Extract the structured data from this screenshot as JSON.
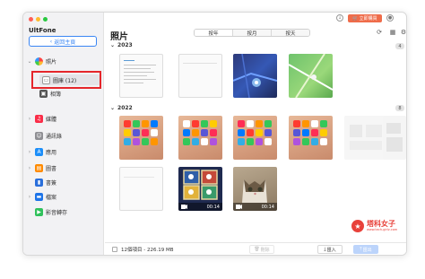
{
  "app": {
    "name": "UltFone",
    "back_label": "返回主頁"
  },
  "sidebar": {
    "photos": "照片",
    "gallery": "圖庫 (12)",
    "albums": "相簿",
    "media": "媒體",
    "contacts": "通訊錄",
    "apps": "應用",
    "books": "圖書",
    "bookmarks": "書簽",
    "files": "檔案",
    "voice_memos": "影音轉存"
  },
  "topbar": {
    "buy": "立即購買"
  },
  "main": {
    "title": "照片",
    "tabs": [
      "按年",
      "按月",
      "按天"
    ],
    "groups": [
      {
        "year": "2023",
        "count": "4"
      },
      {
        "year": "2022",
        "count": "8"
      }
    ],
    "videos": [
      {
        "duration": "00:14"
      },
      {
        "duration": "00:14"
      }
    ]
  },
  "bottombar": {
    "summary": "12個項目 - 226.19 MB",
    "delete": "刪除",
    "import": "匯入",
    "export": "匯出"
  },
  "watermark": {
    "title": "塔科女子",
    "url": "www.tech-girlz.com"
  },
  "colors": {
    "accent": "#3a86f4",
    "buy": "#ef6c4a",
    "highlight": "#e5262b"
  }
}
